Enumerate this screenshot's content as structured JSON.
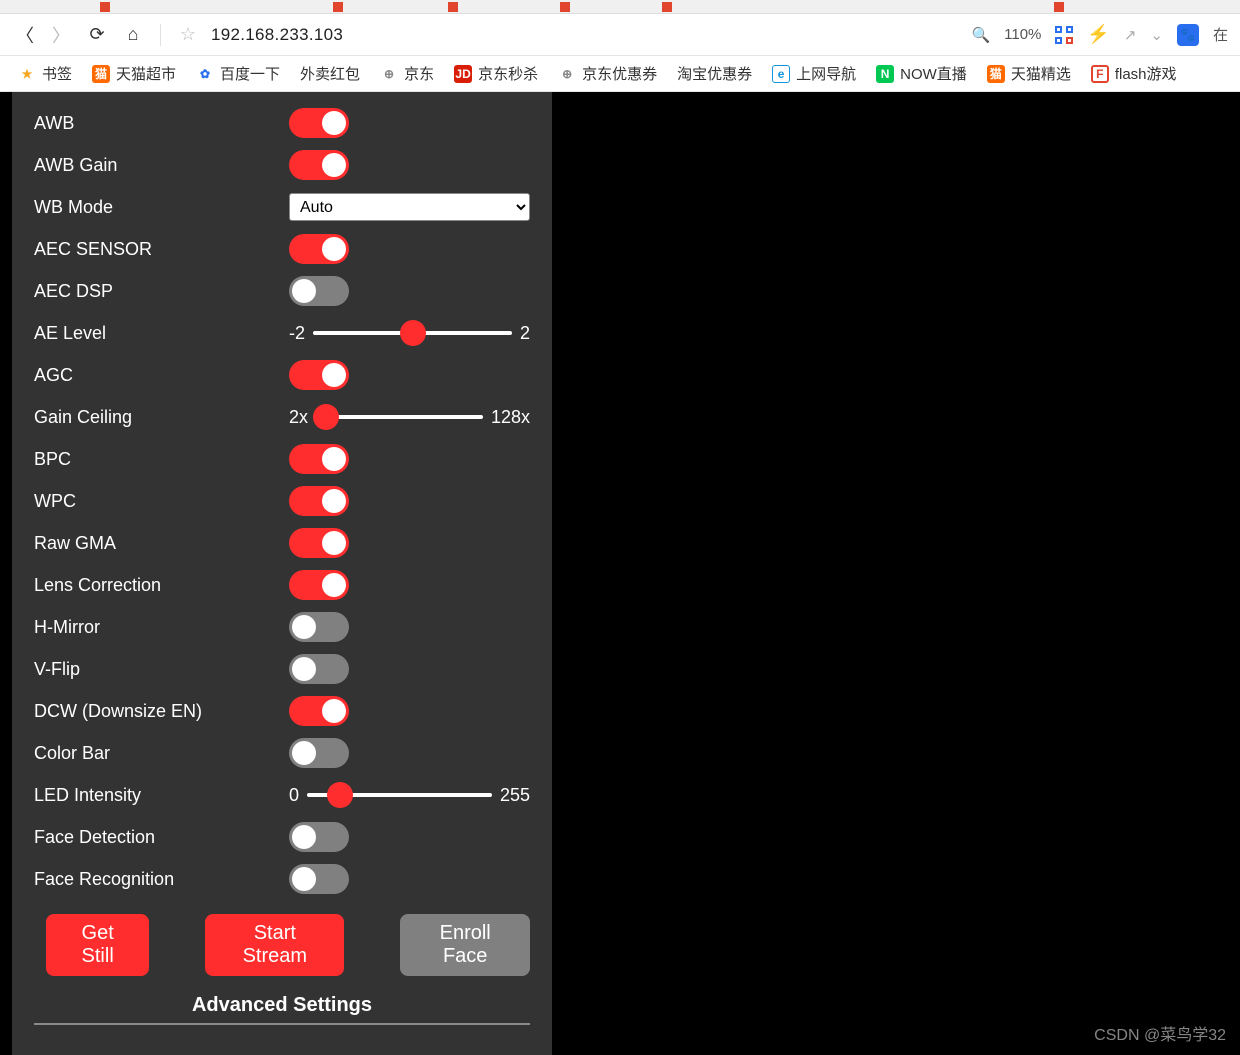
{
  "browser": {
    "url": "192.168.233.103",
    "zoom": "110%",
    "edge_text": "在"
  },
  "bookmarks": [
    {
      "label": "书签",
      "icon": "star"
    },
    {
      "label": "天猫超市",
      "icon": "orange"
    },
    {
      "label": "百度一下",
      "icon": "paw"
    },
    {
      "label": "外卖红包",
      "icon": ""
    },
    {
      "label": "京东",
      "icon": "globe"
    },
    {
      "label": "京东秒杀",
      "icon": "jd"
    },
    {
      "label": "京东优惠券",
      "icon": "globe"
    },
    {
      "label": "淘宝优惠券",
      "icon": ""
    },
    {
      "label": "上网导航",
      "icon": "e"
    },
    {
      "label": "NOW直播",
      "icon": "n"
    },
    {
      "label": "天猫精选",
      "icon": "orange"
    },
    {
      "label": "flash游戏",
      "icon": "f"
    }
  ],
  "settings": {
    "awb": {
      "label": "AWB",
      "type": "toggle",
      "on": true
    },
    "awb_gain": {
      "label": "AWB Gain",
      "type": "toggle",
      "on": true
    },
    "wb_mode": {
      "label": "WB Mode",
      "type": "select",
      "value": "Auto"
    },
    "aec_sensor": {
      "label": "AEC SENSOR",
      "type": "toggle",
      "on": true
    },
    "aec_dsp": {
      "label": "AEC DSP",
      "type": "toggle",
      "on": false
    },
    "ae_level": {
      "label": "AE Level",
      "type": "slider",
      "min": "-2",
      "max": "2",
      "pos": 50
    },
    "agc": {
      "label": "AGC",
      "type": "toggle",
      "on": true
    },
    "gain_ceiling": {
      "label": "Gain Ceiling",
      "type": "slider",
      "min": "2x",
      "max": "128x",
      "pos": 6
    },
    "bpc": {
      "label": "BPC",
      "type": "toggle",
      "on": true
    },
    "wpc": {
      "label": "WPC",
      "type": "toggle",
      "on": true
    },
    "raw_gma": {
      "label": "Raw GMA",
      "type": "toggle",
      "on": true
    },
    "lens_corr": {
      "label": "Lens Correction",
      "type": "toggle",
      "on": true
    },
    "h_mirror": {
      "label": "H-Mirror",
      "type": "toggle",
      "on": false
    },
    "v_flip": {
      "label": "V-Flip",
      "type": "toggle",
      "on": false
    },
    "dcw": {
      "label": "DCW (Downsize EN)",
      "type": "toggle",
      "on": true
    },
    "color_bar": {
      "label": "Color Bar",
      "type": "toggle",
      "on": false
    },
    "led_intensity": {
      "label": "LED Intensity",
      "type": "slider",
      "min": "0",
      "max": "255",
      "pos": 18
    },
    "face_det": {
      "label": "Face Detection",
      "type": "toggle",
      "on": false
    },
    "face_rec": {
      "label": "Face Recognition",
      "type": "toggle",
      "on": false
    }
  },
  "settings_order": [
    "awb",
    "awb_gain",
    "wb_mode",
    "aec_sensor",
    "aec_dsp",
    "ae_level",
    "agc",
    "gain_ceiling",
    "bpc",
    "wpc",
    "raw_gma",
    "lens_corr",
    "h_mirror",
    "v_flip",
    "dcw",
    "color_bar",
    "led_intensity",
    "face_det",
    "face_rec"
  ],
  "actions": {
    "get_still": "Get Still",
    "start_stream": "Start Stream",
    "enroll_face": "Enroll Face"
  },
  "advanced_label": "Advanced Settings",
  "watermark": "CSDN @菜鸟学32"
}
